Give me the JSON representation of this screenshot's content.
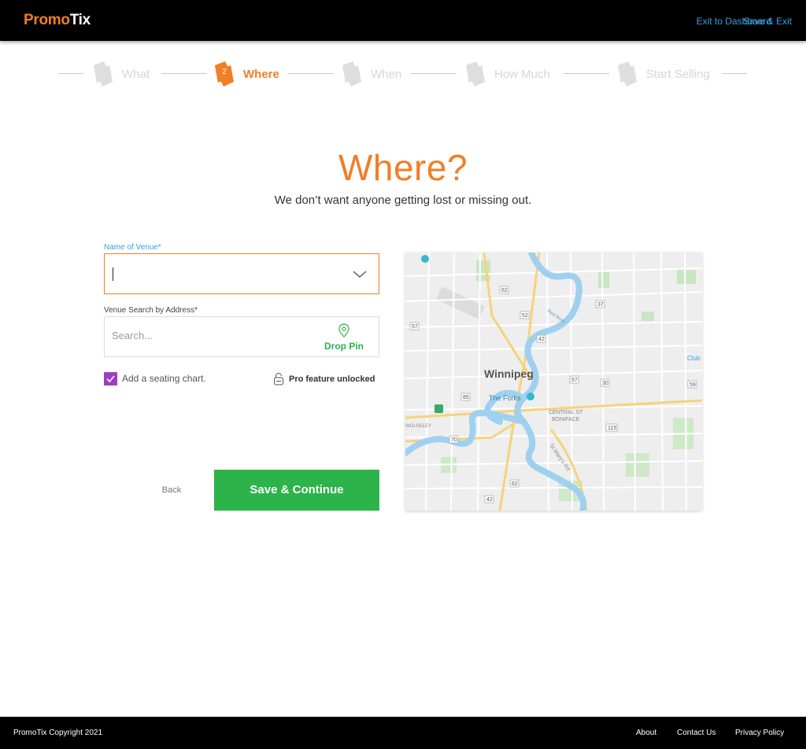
{
  "header": {
    "logo_part1": "Promo",
    "logo_part2": "Tix",
    "exit_link_1": "Exit to Dashboard",
    "exit_link_2": "Save & Exit",
    "link_color": "#3a9fdc"
  },
  "stepper": {
    "steps": [
      {
        "label": "What",
        "state": "inactive"
      },
      {
        "label": "Where",
        "number": "2",
        "state": "active"
      },
      {
        "label": "When",
        "state": "inactive"
      },
      {
        "label": "How Much",
        "state": "inactive"
      },
      {
        "label": "Start Selling",
        "state": "inactive"
      }
    ],
    "active_color": "#f07f26",
    "inactive_color": "#d6d6d6"
  },
  "page": {
    "title": "Where?",
    "subtitle": "We don’t want anyone getting lost or missing out."
  },
  "form": {
    "venue_label": "Name of Venue*",
    "venue_value": "",
    "address_label": "Venue Search by Address*",
    "address_placeholder": "Search...",
    "drop_pin_label": "Drop Pin",
    "seating_label": "Add a seating chart.",
    "seating_checked": true,
    "pro_label": "Pro feature unlocked",
    "back_label": "Back",
    "save_label": "Save & Continue",
    "accent_color": "#2cb34a",
    "checkbox_color": "#9b3fc0"
  },
  "map": {
    "city_label": "Winnipeg",
    "poi_forks": "The Forks",
    "area_boniface_1": "CENTRAL ST",
    "area_boniface_2": "BONIFACE",
    "area_wolseley": "WOLSELEY",
    "road_stmarys": "St Mary's Rd",
    "river_red": "Red River",
    "poi_club": "Club",
    "route_markers": [
      "62",
      "37",
      "52",
      "57",
      "42",
      "30",
      "59",
      "57",
      "85",
      "115",
      "70",
      "62",
      "42"
    ]
  },
  "footer": {
    "copyright": "PromoTix Copyright 2021",
    "links": [
      "About",
      "Contact Us",
      "Privacy Policy"
    ]
  }
}
